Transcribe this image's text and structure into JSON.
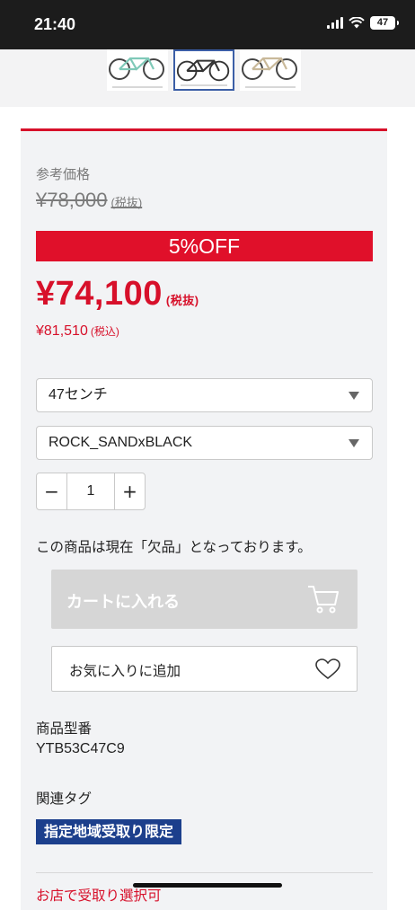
{
  "status_bar": {
    "time": "21:40",
    "battery": "47"
  },
  "thumbnails": [
    {
      "name": "mint",
      "color": "#7fc9b8",
      "selected": false
    },
    {
      "name": "black",
      "color": "#333333",
      "selected": true
    },
    {
      "name": "sand",
      "color": "#c9b99a",
      "selected": false
    }
  ],
  "price": {
    "reference_label": "参考価格",
    "reference_value": "¥78,000",
    "reference_tax": "(税抜)",
    "discount_badge": "5%OFF",
    "sale_value": "¥74,100",
    "sale_tax": "(税抜)",
    "incl_value": "¥81,510",
    "incl_tax": "(税込)"
  },
  "options": {
    "size_selected": "47センチ",
    "color_selected": "ROCK_SANDxBLACK"
  },
  "quantity": {
    "minus": "−",
    "value": "1",
    "plus": "+"
  },
  "stock_message": "この商品は現在「欠品」となっております。",
  "buttons": {
    "cart": "カートに入れる",
    "favorite": "お気に入りに追加"
  },
  "model": {
    "label": "商品型番",
    "value": "YTB53C47C9"
  },
  "tags": {
    "label": "関連タグ",
    "items": [
      "指定地域受取り限定"
    ]
  },
  "store_link": "お店で受取り選択可",
  "colors": {
    "accent_red": "#d7102a",
    "tag_blue": "#1c3f8c",
    "disabled_gray": "#d6d6d6"
  }
}
